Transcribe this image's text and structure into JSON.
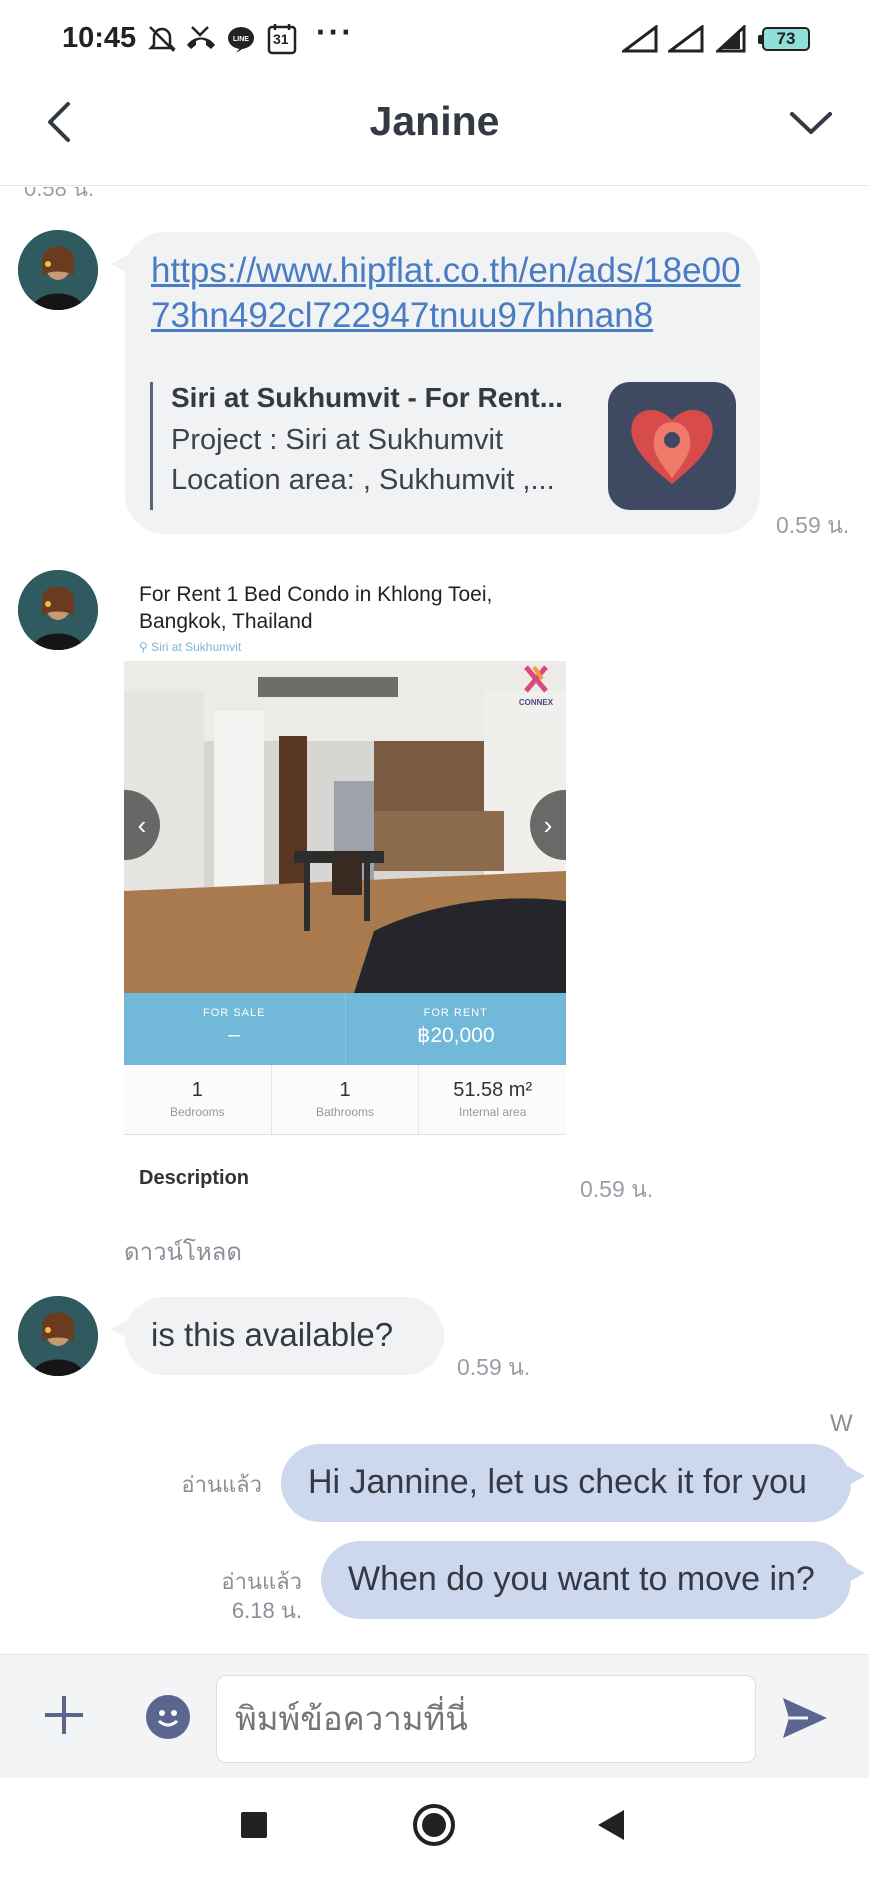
{
  "status_bar": {
    "time": "10:45",
    "calendar_day": "31",
    "more": "···",
    "battery": "73"
  },
  "header": {
    "title": "Janine",
    "back_icon": "chevron-left-icon",
    "menu_icon": "chevron-down-icon"
  },
  "messages": [
    {
      "link": "https://www.hipflat.co.th/en/ads/18e0073hn492cl722947tnuu97hhnan8",
      "preview_title": "Siri at Sukhumvit - For Rent...",
      "preview_line1": "Project : Siri at Sukhumvit",
      "preview_line2": "Location area: , Sukhumvit ,...",
      "time": "0.59 น."
    },
    {
      "image_card": {
        "title": "For Rent 1 Bed Condo in Khlong Toei, Bangkok, Thailand",
        "subtitle": "Siri at Sukhumvit",
        "brand": "CONNEX",
        "for_sale_label": "FOR SALE",
        "for_sale_value": "–",
        "for_rent_label": "FOR RENT",
        "for_rent_value": "฿20,000",
        "bedrooms": "1",
        "bedrooms_label": "Bedrooms",
        "bathrooms": "1",
        "bathrooms_label": "Bathrooms",
        "area": "51.58 m²",
        "area_label": "Internal area",
        "desc_heading": "Description"
      },
      "time": "0.59 น.",
      "download": "ดาวน์โหลด"
    },
    {
      "text": "is this available?",
      "time": "0.59 น."
    }
  ],
  "sender_initial": "W",
  "outgoing": [
    {
      "text": "Hi Jannine, let us check it for you",
      "read": "อ่านแล้ว"
    },
    {
      "text": "When do you want to move in?",
      "read": "อ่านแล้ว",
      "time": "6.18 น."
    }
  ],
  "input": {
    "placeholder": "พิมพ์ข้อความที่นี่"
  },
  "prev_time": "0.58 น."
}
